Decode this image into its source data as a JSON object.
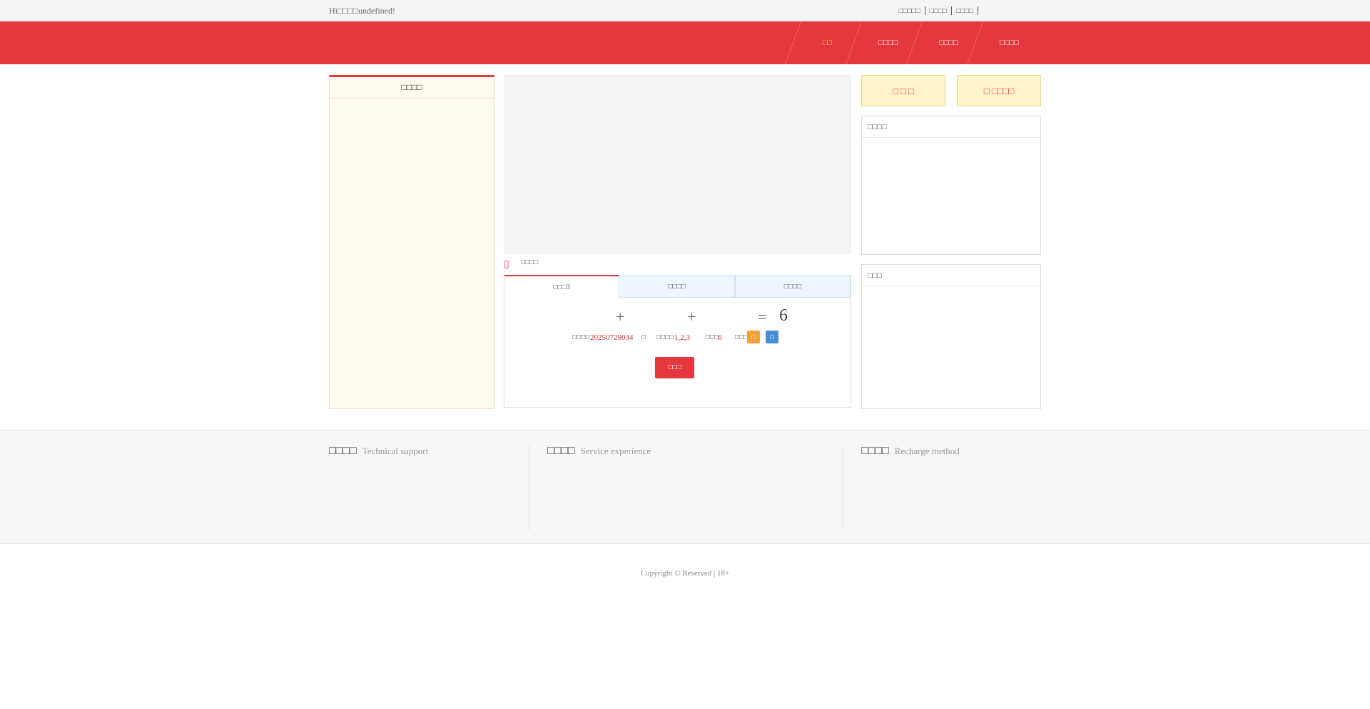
{
  "topbar": {
    "greeting": "Hi□□□□undefined!",
    "links": [
      "□□□□□",
      "□□□□",
      "□□□□"
    ]
  },
  "nav": {
    "items": [
      "□□",
      "□□□□",
      "□□□□",
      "□□□□"
    ],
    "active_index": 0
  },
  "left_panel": {
    "title": "□□□□"
  },
  "lottery": {
    "section_title": "□□□□",
    "title_icon": "lottery-icon",
    "tabs": [
      "□□□3",
      "□□□□",
      "□□□□"
    ],
    "formula": {
      "plus1": "+",
      "plus2": "+",
      "equals": "=",
      "result": "6"
    },
    "issue_label": "□□□□",
    "issue_value": "20250729034",
    "issue_suffix": "□",
    "numbers_label": "□□□□",
    "numbers_value": "1,2,3",
    "sum_label": "□□□",
    "sum_value": "6",
    "shape_label": "□□□",
    "badge1": "□",
    "badge2": "□",
    "bet_button": "□□□"
  },
  "right": {
    "button1": "□ □ □",
    "button2": "□ □□□□",
    "box1_title": "□□□□",
    "box2_title": "□□□"
  },
  "footer": {
    "col1_cn": "□□□□",
    "col1_en": "Technical support",
    "col2_cn": "□□□□",
    "col2_en": "Service experience",
    "col3_cn": "□□□□",
    "col3_en": "Recharge method"
  },
  "copyright": "Copyright © Reserved | 18+",
  "colors": {
    "brand_red": "#e5383e",
    "nav_active": "#ffcf33",
    "panel_bg": "#fffaee"
  }
}
